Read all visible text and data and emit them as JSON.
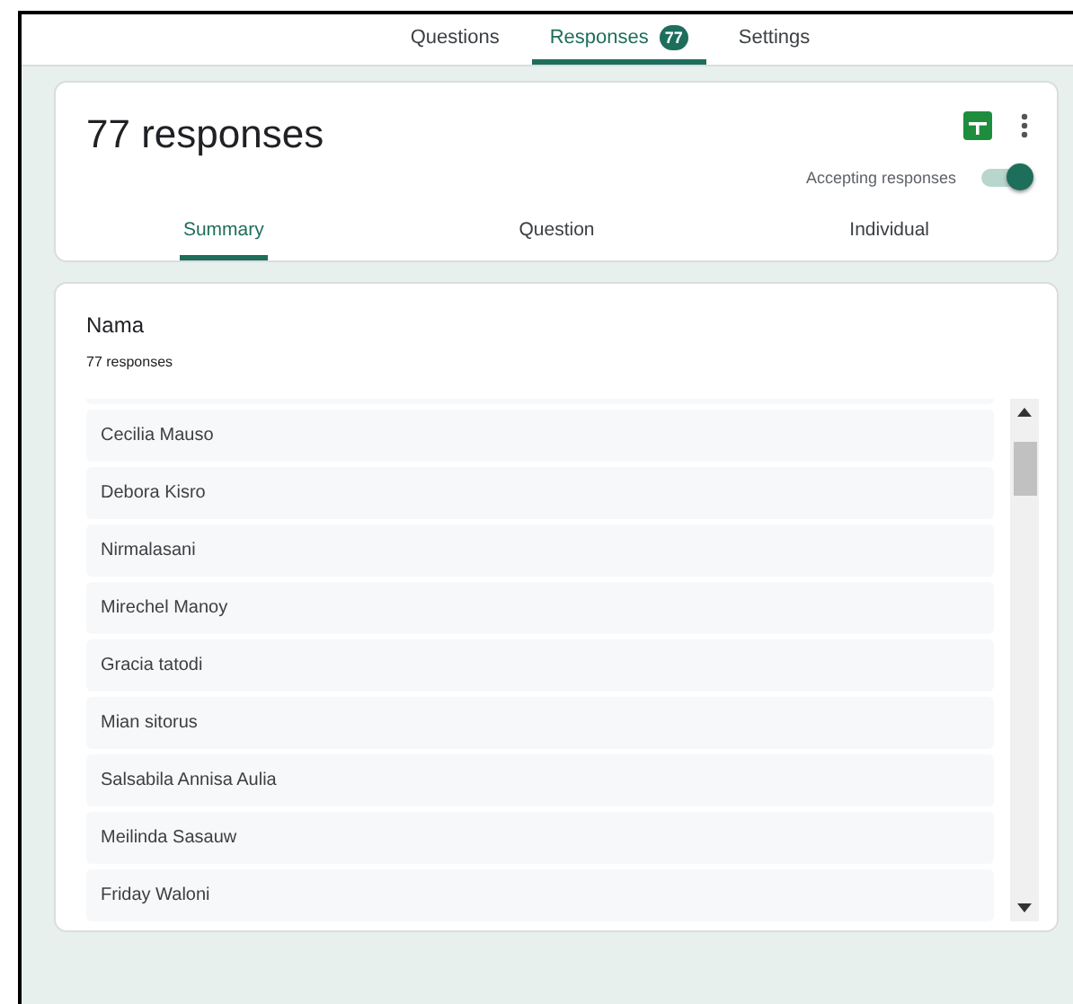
{
  "top_tabs": [
    {
      "label": "Questions",
      "selected": false
    },
    {
      "label": "Responses",
      "selected": true,
      "badge": "77"
    },
    {
      "label": "Settings",
      "selected": false
    }
  ],
  "header": {
    "title": "77 responses",
    "accepting_label": "Accepting responses",
    "accepting": true
  },
  "sub_tabs": [
    {
      "label": "Summary",
      "selected": true
    },
    {
      "label": "Question",
      "selected": false
    },
    {
      "label": "Individual",
      "selected": false
    }
  ],
  "question": {
    "title": "Nama",
    "count": "77 responses",
    "answers": [
      "Cecilia Mauso",
      "Debora Kisro",
      "Nirmalasani",
      "Mirechel Manoy",
      "Gracia tatodi",
      "Mian sitorus",
      "Salsabila Annisa Aulia",
      "Meilinda Sasauw",
      "Friday Waloni"
    ]
  }
}
